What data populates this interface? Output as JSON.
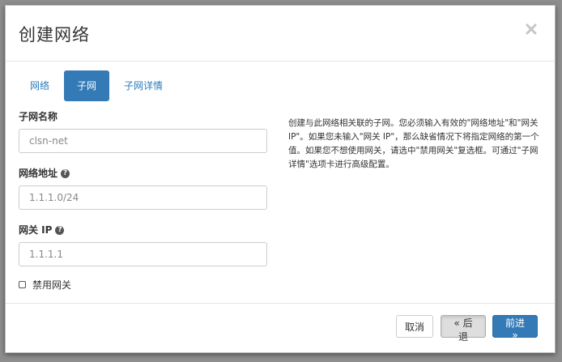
{
  "dialog": {
    "title": "创建网络"
  },
  "tabs": [
    {
      "label": "网络"
    },
    {
      "label": "子网",
      "active": true
    },
    {
      "label": "子网详情"
    }
  ],
  "form": {
    "subnet_name": {
      "label": "子网名称",
      "placeholder": "clsn-net"
    },
    "network_address": {
      "label": "网络地址",
      "placeholder": "1.1.1.0/24"
    },
    "gateway_ip": {
      "label": "网关 IP",
      "placeholder": "1.1.1.1"
    },
    "disable_gateway": {
      "label": "禁用网关",
      "checked": false
    }
  },
  "help_text": "创建与此网络相关联的子网。您必须输入有效的\"网络地址\"和\"网关 IP\"。如果您未输入\"网关 IP\"，那么缺省情况下将指定网络的第一个值。如果您不想使用网关，请选中\"禁用网关\"复选框。可通过\"子网详情\"选项卡进行高级配置。",
  "footer": {
    "cancel_label": "取消",
    "back_label": "« 后退",
    "next_label": "前进 »"
  },
  "icons": {
    "close": "close-icon",
    "help": "question-circle-icon"
  },
  "colors": {
    "primary": "#337ab7",
    "link": "#2a7bbd"
  }
}
